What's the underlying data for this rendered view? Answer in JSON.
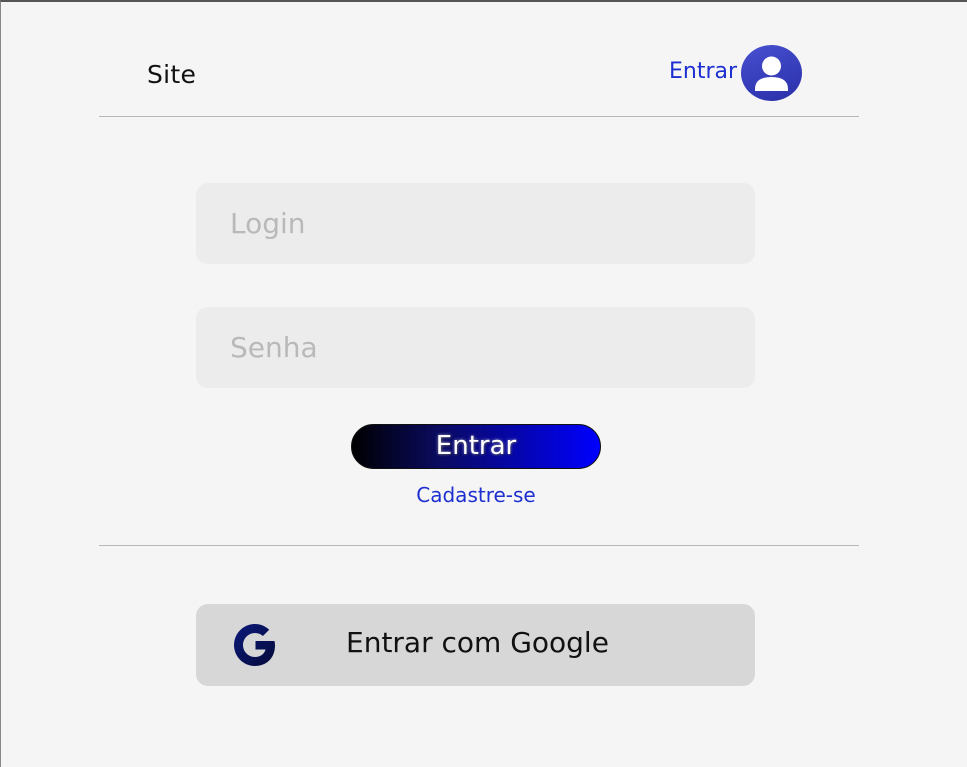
{
  "header": {
    "site_title": "Site",
    "login_link": "Entrar",
    "avatar_icon": "user-avatar-icon"
  },
  "form": {
    "login_placeholder": "Login",
    "password_placeholder": "Senha",
    "submit_label": "Entrar",
    "signup_link": "Cadastre-se"
  },
  "google": {
    "label": "Entrar com Google",
    "icon": "google-icon"
  },
  "colors": {
    "link": "#1d2fd0",
    "button_gradient_start": "#000000",
    "button_gradient_end": "#0000ff",
    "field_background": "#ececec",
    "google_button_background": "#d7d7d7",
    "page_background": "#f5f5f5"
  }
}
